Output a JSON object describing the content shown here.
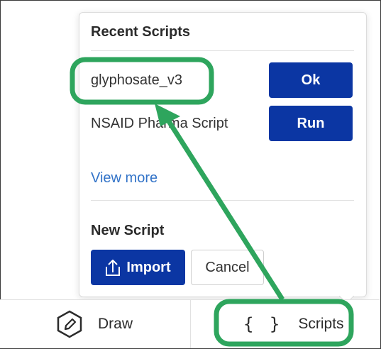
{
  "popover": {
    "recent_title": "Recent Scripts",
    "recent_scripts": [
      {
        "name": "glyphosate_v3",
        "action_label": "Ok"
      },
      {
        "name": "NSAID Pharma Script",
        "action_label": "Run"
      }
    ],
    "view_more_label": "View more",
    "new_title": "New Script",
    "import_label": "Import",
    "cancel_label": "Cancel"
  },
  "bottom_bar": {
    "draw_label": "Draw",
    "draw_icon": "pencil-hexagon-icon",
    "scripts_label": "Scripts",
    "scripts_icon": "braces-icon",
    "scripts_icon_glyph": "{ }"
  },
  "colors": {
    "primary_button": "#0b36a3",
    "link": "#3273c8",
    "annotation_green": "#2ea55d"
  }
}
